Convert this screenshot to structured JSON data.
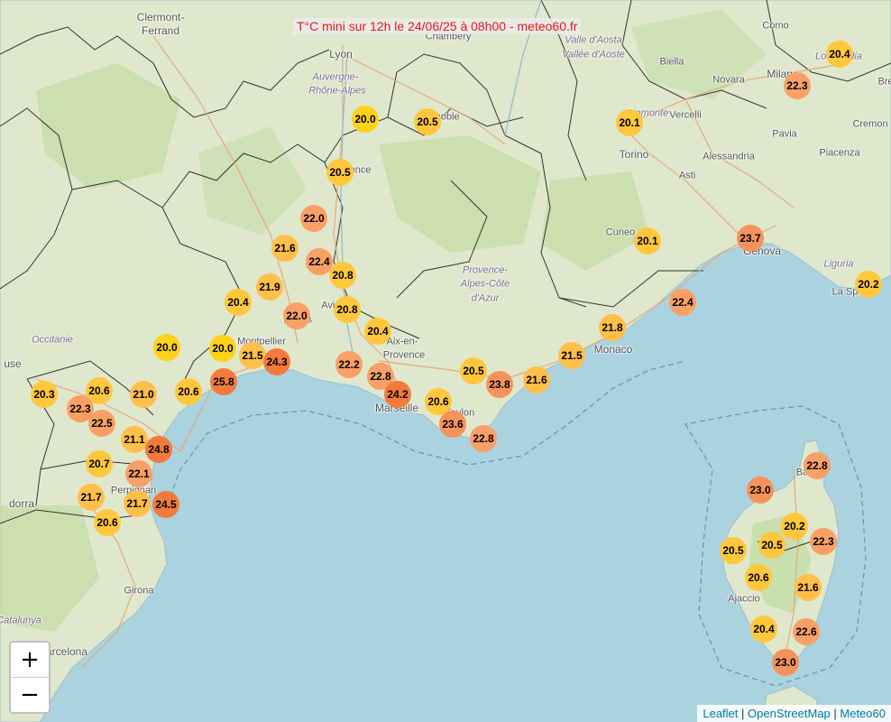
{
  "title": "T°C mini sur 12h le 24/06/25 à 08h00 - meteo60.fr",
  "zoom": {
    "in_label": "+",
    "out_label": "−"
  },
  "attribution": {
    "leaflet": "Leaflet",
    "sep1": " | ",
    "osm": "OpenStreetMap",
    "sep2": " | ",
    "meteo": "Meteo60"
  },
  "colors": {
    "sea": "#aad3df",
    "land": "#dfe8cc",
    "forest": "#c4dca6",
    "border": "#333333",
    "title_text": "#e4181c"
  },
  "color_scale": [
    {
      "max": 20.0,
      "color": "#ffd21a"
    },
    {
      "max": 20.9,
      "color": "#ffc83c"
    },
    {
      "max": 21.9,
      "color": "#ffbf4a"
    },
    {
      "max": 22.9,
      "color": "#f9a066"
    },
    {
      "max": 23.9,
      "color": "#f6925c"
    },
    {
      "max": 99.0,
      "color": "#f47a3c"
    }
  ],
  "places": [
    {
      "name": "Clermont-",
      "cls": ""
    },
    {
      "name": "Ferrand",
      "cls": ""
    },
    {
      "name": "Lyon",
      "cls": ""
    },
    {
      "name": "Auvergne-",
      "cls": "region"
    },
    {
      "name": "Rhône-Alpes",
      "cls": "region"
    },
    {
      "name": "Chambéry",
      "cls": "small"
    },
    {
      "name": "Valle d'Aosta",
      "cls": "region"
    },
    {
      "name": "Vallée d'Aoste",
      "cls": "region"
    },
    {
      "name": "Biella",
      "cls": "small"
    },
    {
      "name": "Novara",
      "cls": "small"
    },
    {
      "name": "Milano",
      "cls": ""
    },
    {
      "name": "Lombardia",
      "cls": "region"
    },
    {
      "name": "Como",
      "cls": "small"
    },
    {
      "name": "Bre",
      "cls": "small"
    },
    {
      "name": "Cremon",
      "cls": "small"
    },
    {
      "name": "Piemonte",
      "cls": "region"
    },
    {
      "name": "Vercelli",
      "cls": "small"
    },
    {
      "name": "Torino",
      "cls": ""
    },
    {
      "name": "Alessandria",
      "cls": "small"
    },
    {
      "name": "Pavia",
      "cls": "small"
    },
    {
      "name": "Piacenza",
      "cls": "small"
    },
    {
      "name": "Asti",
      "cls": "small"
    },
    {
      "name": "Cuneo",
      "cls": "small"
    },
    {
      "name": "Genova",
      "cls": ""
    },
    {
      "name": "Liguria",
      "cls": "region"
    },
    {
      "name": "La Spe",
      "cls": "small"
    },
    {
      "name": "Provence-",
      "cls": "region"
    },
    {
      "name": "Alpes-Côte",
      "cls": "region"
    },
    {
      "name": "d'Azur",
      "cls": "region"
    },
    {
      "name": "Monaco",
      "cls": ""
    },
    {
      "name": "Avignon",
      "cls": "small"
    },
    {
      "name": "Nîmes",
      "cls": "small"
    },
    {
      "name": "Montpellier",
      "cls": "small"
    },
    {
      "name": "Aix-en-",
      "cls": "small"
    },
    {
      "name": "Provence",
      "cls": "small"
    },
    {
      "name": "Marseille",
      "cls": ""
    },
    {
      "name": "Toulon",
      "cls": "small"
    },
    {
      "name": "Occitanie",
      "cls": "region"
    },
    {
      "name": "use",
      "cls": ""
    },
    {
      "name": "dorra",
      "cls": ""
    },
    {
      "name": "Perpignan",
      "cls": "small"
    },
    {
      "name": "Girona",
      "cls": "small"
    },
    {
      "name": "Catalunya",
      "cls": "region"
    },
    {
      "name": "arcelona",
      "cls": ""
    },
    {
      "name": "Bastia",
      "cls": "small"
    },
    {
      "name": "Ajaccio",
      "cls": "small"
    },
    {
      "name": "Grenoble",
      "cls": "small"
    },
    {
      "name": "Valence",
      "cls": "small"
    }
  ],
  "stations": [
    {
      "value": 20.4
    },
    {
      "value": 22.3
    },
    {
      "value": 20.0
    },
    {
      "value": 20.5
    },
    {
      "value": 20.1
    },
    {
      "value": 20.5
    },
    {
      "value": 22.0
    },
    {
      "value": 21.6
    },
    {
      "value": 22.4
    },
    {
      "value": 20.8
    },
    {
      "value": 20.1
    },
    {
      "value": 23.7
    },
    {
      "value": 20.2
    },
    {
      "value": 20.4
    },
    {
      "value": 21.9
    },
    {
      "value": 22.0
    },
    {
      "value": 20.8
    },
    {
      "value": 22.4
    },
    {
      "value": 20.4
    },
    {
      "value": 21.8
    },
    {
      "value": 20.0
    },
    {
      "value": 20.0
    },
    {
      "value": 21.5
    },
    {
      "value": 24.3
    },
    {
      "value": 22.2
    },
    {
      "value": 22.8
    },
    {
      "value": 24.2
    },
    {
      "value": 20.5
    },
    {
      "value": 23.8
    },
    {
      "value": 21.6
    },
    {
      "value": 21.5
    },
    {
      "value": 20.3
    },
    {
      "value": 20.6
    },
    {
      "value": 21.0
    },
    {
      "value": 20.6
    },
    {
      "value": 25.8
    },
    {
      "value": 22.3
    },
    {
      "value": 22.5
    },
    {
      "value": 20.6
    },
    {
      "value": 23.6
    },
    {
      "value": 22.8
    },
    {
      "value": 21.1
    },
    {
      "value": 24.8
    },
    {
      "value": 20.7
    },
    {
      "value": 22.1
    },
    {
      "value": 21.7
    },
    {
      "value": 21.7
    },
    {
      "value": 24.5
    },
    {
      "value": 20.6
    },
    {
      "value": 22.8
    },
    {
      "value": 23.0
    },
    {
      "value": 20.2
    },
    {
      "value": 20.5
    },
    {
      "value": 20.5
    },
    {
      "value": 22.3
    },
    {
      "value": 20.6
    },
    {
      "value": 21.6
    },
    {
      "value": 20.4
    },
    {
      "value": 22.6
    },
    {
      "value": 23.0
    }
  ]
}
